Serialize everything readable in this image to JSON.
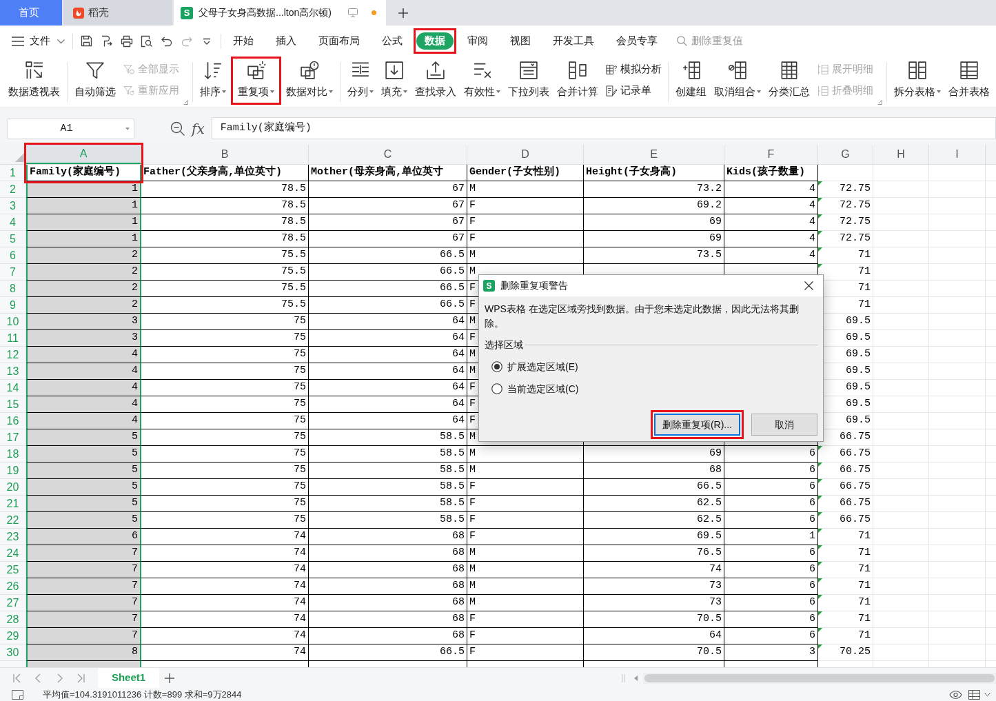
{
  "tab_bar": {
    "tabs": [
      {
        "kind": "home",
        "label": "首页",
        "selected": false
      },
      {
        "kind": "docer",
        "label": "稻壳",
        "selected": false
      },
      {
        "kind": "document",
        "icon_letter": "S",
        "label": "父母子女身高数据...lton高尔顿)",
        "selected": true,
        "unsaved": true
      }
    ]
  },
  "menu_bar": {
    "file_label": "文件",
    "quick_access": [
      {
        "disabled": false
      },
      {
        "disabled": false
      },
      {
        "disabled": false
      },
      {
        "disabled": false
      },
      {
        "disabled": false
      },
      {
        "disabled": true
      },
      {
        "disabled": false
      }
    ],
    "tabs": [
      {
        "label": "开始",
        "selected": false,
        "marked": false
      },
      {
        "label": "插入",
        "selected": false,
        "marked": false
      },
      {
        "label": "页面布局",
        "selected": false,
        "marked": false
      },
      {
        "label": "公式",
        "selected": false,
        "marked": false
      },
      {
        "label": "数据",
        "selected": true,
        "marked": true
      },
      {
        "label": "审阅",
        "selected": false,
        "marked": false
      },
      {
        "label": "视图",
        "selected": false,
        "marked": false
      },
      {
        "label": "开发工具",
        "selected": false,
        "marked": false
      },
      {
        "label": "会员专享",
        "selected": false,
        "marked": false
      }
    ],
    "search": {
      "placeholder": "删除重复值"
    }
  },
  "ribbon": {
    "groups": [
      {
        "launcher": false,
        "items": [
          {
            "kind": "large",
            "label": "数据透视表",
            "dropdown": false,
            "marked": false
          }
        ]
      },
      {
        "launcher": true,
        "items": [
          {
            "kind": "large",
            "label": "自动筛选",
            "dropdown": false,
            "marked": false
          },
          {
            "kind": "stack",
            "entries": [
              {
                "label": "全部显示",
                "disabled": true
              },
              {
                "label": "重新应用",
                "disabled": true
              }
            ]
          }
        ]
      },
      {
        "launcher": false,
        "items": [
          {
            "kind": "large",
            "label": "排序",
            "dropdown": true,
            "marked": false
          },
          {
            "kind": "large",
            "label": "重复项",
            "dropdown": true,
            "marked": true
          },
          {
            "kind": "large",
            "label": "数据对比",
            "dropdown": true,
            "marked": false
          }
        ]
      },
      {
        "launcher": false,
        "items": [
          {
            "kind": "large",
            "label": "分列",
            "dropdown": true,
            "marked": false
          },
          {
            "kind": "large",
            "label": "填充",
            "dropdown": true,
            "marked": false
          },
          {
            "kind": "large",
            "label": "查找录入",
            "dropdown": false,
            "marked": false
          },
          {
            "kind": "large",
            "label": "有效性",
            "dropdown": true,
            "marked": false
          },
          {
            "kind": "large",
            "label": "下拉列表",
            "dropdown": false,
            "marked": false
          },
          {
            "kind": "large",
            "label": "合并计算",
            "dropdown": false,
            "marked": false
          },
          {
            "kind": "stack",
            "entries": [
              {
                "label": "模拟分析",
                "disabled": false
              },
              {
                "label": "记录单",
                "disabled": false
              }
            ]
          }
        ]
      },
      {
        "launcher": true,
        "items": [
          {
            "kind": "large",
            "label": "创建组",
            "dropdown": false,
            "marked": false
          },
          {
            "kind": "large",
            "label": "取消组合",
            "dropdown": true,
            "marked": false
          },
          {
            "kind": "large",
            "label": "分类汇总",
            "dropdown": false,
            "marked": false
          },
          {
            "kind": "stack",
            "entries": [
              {
                "label": "展开明细",
                "disabled": true
              },
              {
                "label": "折叠明细",
                "disabled": true
              }
            ]
          }
        ]
      },
      {
        "launcher": false,
        "items": [
          {
            "kind": "large",
            "label": "拆分表格",
            "dropdown": true,
            "marked": false
          },
          {
            "kind": "large",
            "label": "合并表格",
            "dropdown": false,
            "marked": false
          }
        ]
      }
    ]
  },
  "formula_bar": {
    "name_box": "A1",
    "function_label": "fx",
    "formula": "Family(家庭编号)"
  },
  "sheet": {
    "columns": [
      {
        "label": "A",
        "kind": "number",
        "selected": true,
        "marked": true
      },
      {
        "label": "B",
        "kind": "number",
        "selected": false,
        "marked": false
      },
      {
        "label": "C",
        "kind": "number",
        "selected": false,
        "marked": false
      },
      {
        "label": "D",
        "kind": "text",
        "selected": false,
        "marked": false
      },
      {
        "label": "E",
        "kind": "number",
        "selected": false,
        "marked": false
      },
      {
        "label": "F",
        "kind": "number",
        "selected": false,
        "marked": false
      },
      {
        "label": "G",
        "kind": "number",
        "selected": false,
        "marked": false
      },
      {
        "label": "H",
        "selected": false,
        "marked": false
      },
      {
        "label": "I",
        "selected": false,
        "marked": false
      }
    ],
    "rows": [
      {
        "number": "1",
        "kind": "heading",
        "active": true,
        "flagged": false,
        "cells": [
          "Family(家庭编号)",
          "Father(父亲身高,单位英寸)",
          "Mother(母亲身高,单位英寸",
          "Gender(子女性别)",
          "Height(子女身高)",
          "Kids(孩子数量)"
        ]
      },
      {
        "number": "2",
        "kind": "data",
        "active": false,
        "flagged": true,
        "cells": [
          "1",
          "78.5",
          "67",
          "M",
          "73.2",
          "4",
          "72.75"
        ]
      },
      {
        "number": "3",
        "kind": "data",
        "active": false,
        "flagged": true,
        "cells": [
          "1",
          "78.5",
          "67",
          "F",
          "69.2",
          "4",
          "72.75"
        ]
      },
      {
        "number": "4",
        "kind": "data",
        "active": false,
        "flagged": true,
        "cells": [
          "1",
          "78.5",
          "67",
          "F",
          "69",
          "4",
          "72.75"
        ]
      },
      {
        "number": "5",
        "kind": "data",
        "active": false,
        "flagged": true,
        "cells": [
          "1",
          "78.5",
          "67",
          "F",
          "69",
          "4",
          "72.75"
        ]
      },
      {
        "number": "6",
        "kind": "data",
        "active": false,
        "flagged": true,
        "cells": [
          "2",
          "75.5",
          "66.5",
          "M",
          "73.5",
          "4",
          "71"
        ]
      },
      {
        "number": "7",
        "kind": "data",
        "active": false,
        "flagged": true,
        "cells": [
          "2",
          "75.5",
          "66.5",
          "M",
          null,
          null,
          "71"
        ]
      },
      {
        "number": "8",
        "kind": "data",
        "active": false,
        "flagged": false,
        "cells": [
          "2",
          "75.5",
          "66.5",
          "F",
          null,
          null,
          "71"
        ]
      },
      {
        "number": "9",
        "kind": "data",
        "active": false,
        "flagged": false,
        "cells": [
          "2",
          "75.5",
          "66.5",
          "F",
          null,
          null,
          "71"
        ]
      },
      {
        "number": "10",
        "kind": "data",
        "active": false,
        "flagged": false,
        "cells": [
          "3",
          "75",
          "64",
          "M",
          null,
          null,
          "69.5"
        ]
      },
      {
        "number": "11",
        "kind": "data",
        "active": false,
        "flagged": false,
        "cells": [
          "3",
          "75",
          "64",
          "F",
          null,
          null,
          "69.5"
        ]
      },
      {
        "number": "12",
        "kind": "data",
        "active": false,
        "flagged": false,
        "cells": [
          "4",
          "75",
          "64",
          "M",
          null,
          null,
          "69.5"
        ]
      },
      {
        "number": "13",
        "kind": "data",
        "active": false,
        "flagged": false,
        "cells": [
          "4",
          "75",
          "64",
          "M",
          null,
          null,
          "69.5"
        ]
      },
      {
        "number": "14",
        "kind": "data",
        "active": false,
        "flagged": false,
        "cells": [
          "4",
          "75",
          "64",
          "F",
          null,
          null,
          "69.5"
        ]
      },
      {
        "number": "15",
        "kind": "data",
        "active": false,
        "flagged": false,
        "cells": [
          "4",
          "75",
          "64",
          "F",
          null,
          null,
          "69.5"
        ]
      },
      {
        "number": "16",
        "kind": "data",
        "active": false,
        "flagged": false,
        "cells": [
          "4",
          "75",
          "64",
          "F",
          null,
          null,
          "69.5"
        ]
      },
      {
        "number": "17",
        "kind": "data",
        "active": false,
        "flagged": false,
        "cells": [
          "5",
          "75",
          "58.5",
          "M",
          null,
          null,
          "66.75"
        ]
      },
      {
        "number": "18",
        "kind": "data",
        "active": false,
        "flagged": true,
        "cells": [
          "5",
          "75",
          "58.5",
          "M",
          "69",
          "6",
          "66.75"
        ]
      },
      {
        "number": "19",
        "kind": "data",
        "active": false,
        "flagged": true,
        "cells": [
          "5",
          "75",
          "58.5",
          "M",
          "68",
          "6",
          "66.75"
        ]
      },
      {
        "number": "20",
        "kind": "data",
        "active": false,
        "flagged": true,
        "cells": [
          "5",
          "75",
          "58.5",
          "F",
          "66.5",
          "6",
          "66.75"
        ]
      },
      {
        "number": "21",
        "kind": "data",
        "active": false,
        "flagged": true,
        "cells": [
          "5",
          "75",
          "58.5",
          "F",
          "62.5",
          "6",
          "66.75"
        ]
      },
      {
        "number": "22",
        "kind": "data",
        "active": false,
        "flagged": true,
        "cells": [
          "5",
          "75",
          "58.5",
          "F",
          "62.5",
          "6",
          "66.75"
        ]
      },
      {
        "number": "23",
        "kind": "data",
        "active": false,
        "flagged": true,
        "cells": [
          "6",
          "74",
          "68",
          "F",
          "69.5",
          "1",
          "71"
        ]
      },
      {
        "number": "24",
        "kind": "data",
        "active": false,
        "flagged": true,
        "cells": [
          "7",
          "74",
          "68",
          "M",
          "76.5",
          "6",
          "71"
        ]
      },
      {
        "number": "25",
        "kind": "data",
        "active": false,
        "flagged": true,
        "cells": [
          "7",
          "74",
          "68",
          "M",
          "74",
          "6",
          "71"
        ]
      },
      {
        "number": "26",
        "kind": "data",
        "active": false,
        "flagged": true,
        "cells": [
          "7",
          "74",
          "68",
          "M",
          "73",
          "6",
          "71"
        ]
      },
      {
        "number": "27",
        "kind": "data",
        "active": false,
        "flagged": true,
        "cells": [
          "7",
          "74",
          "68",
          "M",
          "73",
          "6",
          "71"
        ]
      },
      {
        "number": "28",
        "kind": "data",
        "active": false,
        "flagged": true,
        "cells": [
          "7",
          "74",
          "68",
          "F",
          "70.5",
          "6",
          "71"
        ]
      },
      {
        "number": "29",
        "kind": "data",
        "active": false,
        "flagged": true,
        "cells": [
          "7",
          "74",
          "68",
          "F",
          "64",
          "6",
          "71"
        ]
      },
      {
        "number": "30",
        "kind": "data",
        "active": false,
        "flagged": true,
        "cells": [
          "8",
          "74",
          "66.5",
          "F",
          "70.5",
          "3",
          "70.25"
        ]
      }
    ]
  },
  "sheet_tabs": [
    {
      "label": "Sheet1",
      "selected": true
    }
  ],
  "status_bar": {
    "summary": "平均值=104.3191011236 计数=899 求和=9万2844"
  },
  "dialog": {
    "icon_letter": "S",
    "title": "删除重复项警告",
    "message": "WPS表格 在选定区域旁找到数据。由于您未选定此数据，因此无法将其删除。",
    "group_label": "选择区域",
    "options": [
      {
        "label": "扩展选定区域(E)",
        "selected": true
      },
      {
        "label": "当前选定区域(C)",
        "selected": false
      }
    ],
    "buttons": [
      {
        "label": "删除重复项(R)...",
        "focused": true,
        "marked": true
      },
      {
        "label": "取消",
        "focused": false,
        "marked": false
      }
    ]
  }
}
